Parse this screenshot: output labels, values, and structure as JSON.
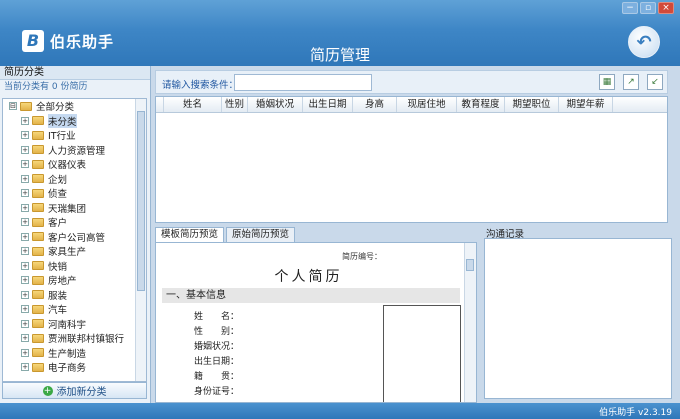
{
  "app": {
    "name": "伯乐助手",
    "page_title": "简历管理",
    "version": "伯乐助手 v2.3.19",
    "brand_color": "#2f77b9"
  },
  "window_controls": {
    "minimize": "−",
    "restore": "▫",
    "close": "×"
  },
  "sidebar": {
    "header": "简历分类",
    "count_text": "当前分类有  0  份简历",
    "root": {
      "label": "全部分类",
      "expander": "⊟"
    },
    "items": [
      {
        "label": "未分类",
        "selected": true
      },
      {
        "label": "IT行业"
      },
      {
        "label": "人力资源管理"
      },
      {
        "label": "仪器仪表"
      },
      {
        "label": "企划"
      },
      {
        "label": "侦查"
      },
      {
        "label": "天瑞集团"
      },
      {
        "label": "客户"
      },
      {
        "label": "客户公司高管"
      },
      {
        "label": "家具生产"
      },
      {
        "label": "快销"
      },
      {
        "label": "房地产"
      },
      {
        "label": "服装"
      },
      {
        "label": "汽车"
      },
      {
        "label": "河南科宇"
      },
      {
        "label": "贾洲联邦村镇银行"
      },
      {
        "label": "生产制造"
      },
      {
        "label": "电子商务"
      }
    ],
    "expander_symbol": "+",
    "add_button": "添加新分类"
  },
  "search": {
    "label": "请输入搜索条件：",
    "value": "",
    "placeholder": ""
  },
  "toolbar_icons": [
    "table-icon",
    "export-icon",
    "import-icon"
  ],
  "grid": {
    "columns": [
      "姓名",
      "性别",
      "婚姻状况",
      "出生日期",
      "身高",
      "现居住地",
      "教育程度",
      "期望职位",
      "期望年薪"
    ]
  },
  "preview": {
    "tabs": [
      {
        "label": "模板简历预览",
        "active": true
      },
      {
        "label": "原始简历预览",
        "active": false
      }
    ],
    "resume_no_label": "简历编号：",
    "resume_title": "个人简历",
    "section_basic": "一、基本信息",
    "fields": [
      "姓　　名：",
      "性　　别：",
      "婚姻状况：",
      "出生日期：",
      "籍　　贯：",
      "身份证号："
    ]
  },
  "communication": {
    "label": "沟通记录"
  }
}
